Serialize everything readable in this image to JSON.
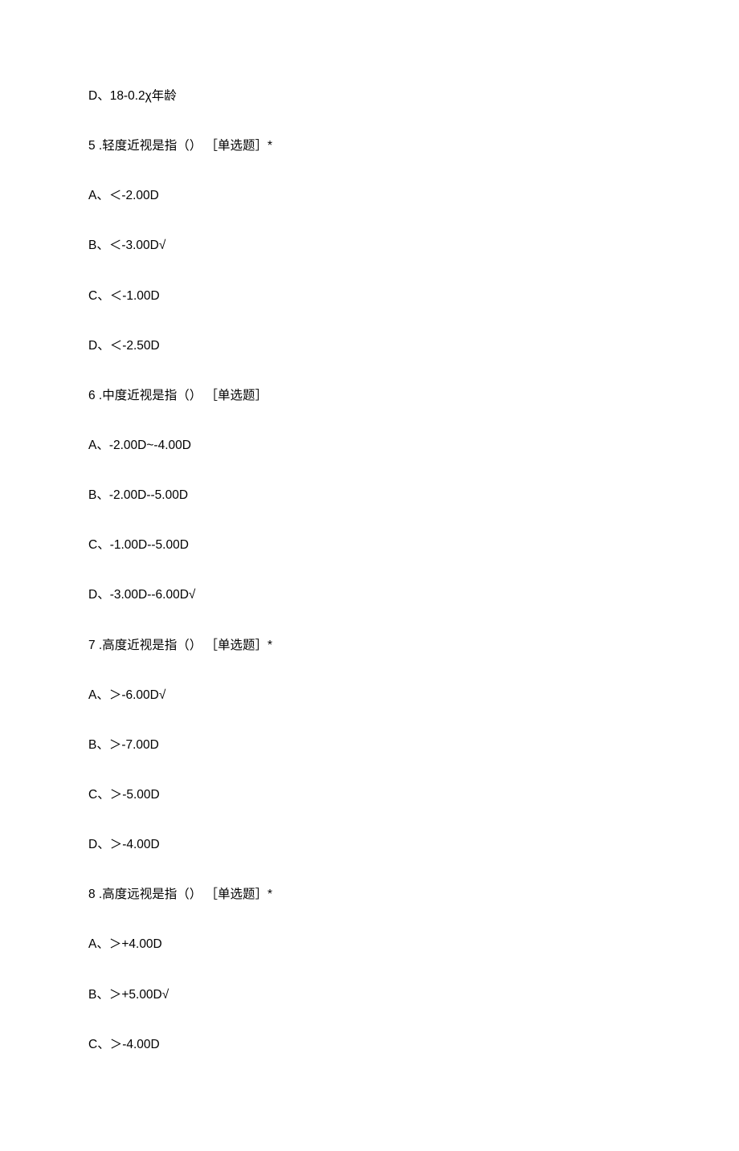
{
  "lines": [
    "D、18-0.2χ年龄",
    "5   .轻度近视是指（） ［单选题］*",
    "A、＜-2.00D",
    "B、＜-3.00D√",
    "C、＜-1.00D",
    "D、＜-2.50D",
    "6   .中度近视是指（） ［单选题］",
    "A、-2.00D~-4.00D",
    "B、-2.00D--5.00D",
    "C、-1.00D--5.00D",
    "D、-3.00D--6.00D√",
    "7   .高度近视是指（） ［单选题］*",
    "A、＞-6.00D√",
    "B、＞-7.00D",
    "C、＞-5.00D",
    "D、＞-4.00D",
    "8   .高度远视是指（） ［单选题］*",
    "A、＞+4.00D",
    "B、＞+5.00D√",
    "C、＞-4.00D"
  ]
}
